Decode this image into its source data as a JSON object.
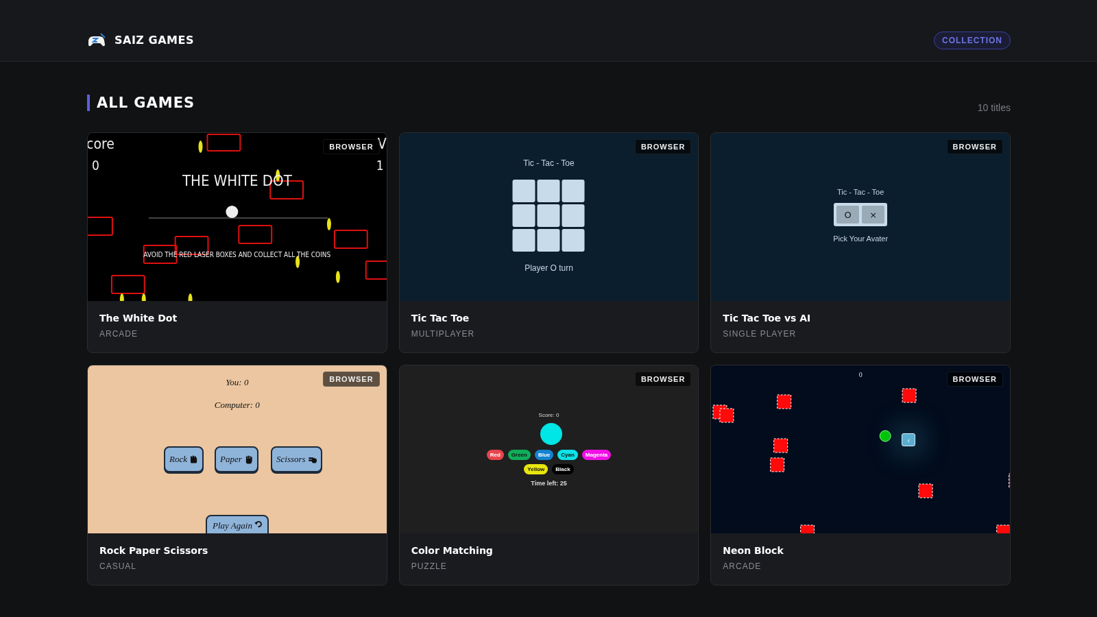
{
  "header": {
    "brand": "SAIZ GAMES",
    "pill": "COLLECTION"
  },
  "section": {
    "title": "ALL GAMES",
    "count": "10 titles"
  },
  "games": [
    {
      "title": "The White Dot",
      "genre": "ARCADE",
      "badge": "BROWSER",
      "screen": {
        "kind": "white-dot",
        "score_label": "core",
        "score": "0",
        "right_value": "1",
        "right_label": "V",
        "title": "THE WHITE DOT",
        "hint": "AVOID THE RED LASER BOXES AND COLLECT ALL THE COINS"
      }
    },
    {
      "title": "Tic Tac Toe",
      "genre": "MULTIPLAYER",
      "badge": "BROWSER",
      "screen": {
        "kind": "tic-tac-toe",
        "heading": "Tic - Tac - Toe",
        "status": "Player O turn"
      }
    },
    {
      "title": "Tic Tac Toe vs AI",
      "genre": "SINGLE PLAYER",
      "badge": "BROWSER",
      "screen": {
        "kind": "avatar-pick",
        "heading": "Tic - Tac - Toe",
        "options": [
          "O",
          "×"
        ],
        "prompt": "Pick Your Avater"
      }
    },
    {
      "title": "Rock Paper Scissors",
      "genre": "CASUAL",
      "badge": "BROWSER",
      "screen": {
        "kind": "rps",
        "you": "You: 0",
        "computer": "Computer: 0",
        "choices": [
          "Rock",
          "Paper",
          "Scissors"
        ],
        "again": "Play Again"
      }
    },
    {
      "title": "Color Matching",
      "genre": "PUZZLE",
      "badge": "BROWSER",
      "screen": {
        "kind": "color-match",
        "score": "Score: 0",
        "colors": [
          {
            "label": "Red",
            "color": "#e8454d"
          },
          {
            "label": "Green",
            "color": "#0fae5a"
          },
          {
            "label": "Blue",
            "color": "#1383d1"
          },
          {
            "label": "Cyan",
            "color": "#0ee3e6"
          },
          {
            "label": "Magenta",
            "color": "#f010e6"
          },
          {
            "label": "Yellow",
            "color": "#e8e60e"
          },
          {
            "label": "Black",
            "color": "#000000"
          }
        ],
        "timer": "Time left: 25"
      }
    },
    {
      "title": "Neon Block",
      "genre": "ARCADE",
      "badge": "BROWSER",
      "screen": {
        "kind": "neon-block",
        "score": "0",
        "key": "‹"
      }
    }
  ]
}
